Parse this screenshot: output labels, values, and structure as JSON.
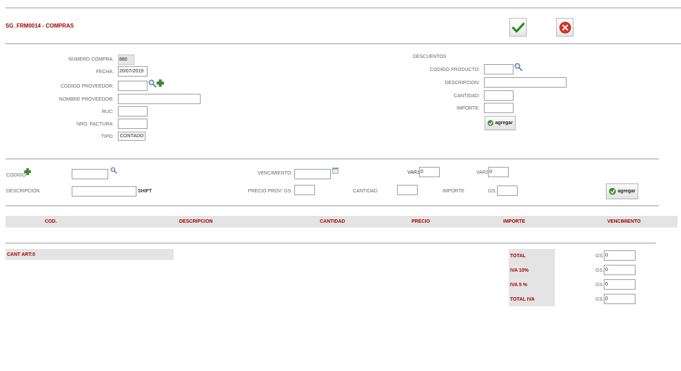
{
  "header": {
    "title": "SG_FRM0014 - COMPRAS"
  },
  "actions": {
    "confirm": "confirm",
    "cancel": "cancel"
  },
  "compra": {
    "numero_label": "NUMERO COMPRA:",
    "numero_value": "880",
    "fecha_label": "FECHA:",
    "fecha_value": "20/07/2019",
    "codigo_proveedor_label": "CODIGO PROVEEDOR:",
    "codigo_proveedor_value": "",
    "nombre_proveedor_label": "NOMBRE PROVEEDOR:",
    "nombre_proveedor_value": "",
    "ruc_label": "RUC:",
    "ruc_value": "",
    "nro_factura_label": "NRO. FACTURA:",
    "nro_factura_value": "",
    "tipo_label": "TIPO:",
    "tipo_value": "CONTADO"
  },
  "descuentos": {
    "title": "DESCUENTOS",
    "codigo_producto_label": "CODIGO PRODUCTO:",
    "codigo_producto_value": "",
    "descripcion_label": "DESCRIPCION:",
    "descripcion_value": "",
    "cantidad_label": "CANTIDAD:",
    "cantidad_value": "",
    "importe_label": "IMPORTE:",
    "importe_value": "",
    "agregar_label": "agregar"
  },
  "item": {
    "codigo_label": "CODIGO",
    "codigo_value": "",
    "descripcion_label": "DESCRIPCION",
    "descripcion_value": "",
    "shift_label": "SHIFT",
    "vencimiento_label": "VENCIMIENTO:",
    "vencimiento_value": "",
    "precio_prov_label": "PRECIO PROV: GS.",
    "precio_prov_value": "",
    "cantidad_label": "CANTIDAD",
    "cantidad_value": "",
    "importe_label": "IMPORTE",
    "importe_currency": "GS.",
    "importe_value": "",
    "var1_label": "VAR1",
    "var1_value": "0",
    "var2_label": "VAR2",
    "var2_value": "0",
    "agregar_label": "agregar"
  },
  "table": {
    "columns": [
      "COD.",
      "DESCRIPCION",
      "CANTIDAD",
      "PRECIO",
      "IMPORTE",
      "VENCIMIENTO"
    ]
  },
  "footer": {
    "cant_art": "CANT ART:0"
  },
  "totals": {
    "currency": "GS.",
    "rows": [
      {
        "label": "TOTAL",
        "value": "0"
      },
      {
        "label": "IVA 10%",
        "value": "0"
      },
      {
        "label": "IVA 5 %",
        "value": "0"
      },
      {
        "label": "TOTAL IVA",
        "value": "0"
      }
    ]
  },
  "colors": {
    "accent": "#a30000",
    "confirm_green": "#2e8b1a",
    "cancel_red": "#d9342b"
  }
}
